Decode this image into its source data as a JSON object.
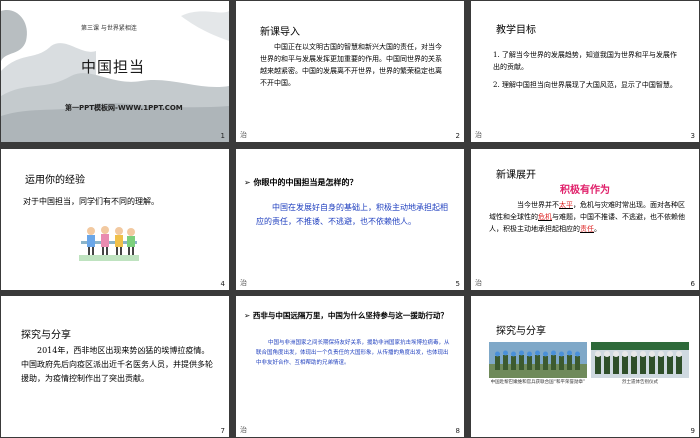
{
  "slides": [
    {
      "num": "1",
      "label": "第三课 与世界紧相连",
      "title": "中国担当",
      "subtitle": "第一PPT模板网-WWW.1PPT.COM"
    },
    {
      "num": "2",
      "footer": "治",
      "title": "新课导入",
      "text": "中国正在以文明古国的智慧和新兴大国的责任，对当今世界的和平与发展发挥更加重要的作用。中国同世界的关系越来越紧密。中国的发展离不开世界，世界的繁荣稳定也离不开中国。"
    },
    {
      "num": "3",
      "footer": "治",
      "title": "教学目标",
      "items": [
        "了解当今世界的发展趋势，知道我国为世界和平与发展作出的贡献。",
        "理解中国担当向世界展现了大国风范，显示了中国智慧。"
      ]
    },
    {
      "num": "4",
      "title": "运用你的经验",
      "text": "对于中国担当，同学们有不同的理解。"
    },
    {
      "num": "5",
      "footer": "治",
      "question": "你眼中的中国担当是怎样的？",
      "answer": "中国在发展好自身的基础上，积极主动地承担起相应的责任，不推诿、不逃避，也不依赖他人。"
    },
    {
      "num": "6",
      "footer": "治",
      "title": "新课展开",
      "heading": "积极有作为",
      "text_1": "当今世界并不",
      "blank_1": "太平",
      "text_2": "，危机与灾难时常出现。面对各种区域性和全球性的",
      "blank_2": "危机",
      "text_3": "与难题，中国不推诿、不逃避，也不依赖他人，积极主动地承担起相应的",
      "blank_3": "责任",
      "text_4": "。"
    },
    {
      "num": "7",
      "title": "探究与分享",
      "text": "2014年，西非地区出现来势凶猛的埃博拉疫情。中国政府先后向疫区派出近千名医务人员，并提供多轮援助，为疫情控制作出了突出贡献。"
    },
    {
      "num": "8",
      "footer": "治",
      "question": "西非与中国远隔万里，中国为什么坚持参与这一援助行动？",
      "answer": "中国与非洲国家之间长期保持友好关系，援助非洲国家抗击埃博拉病毒，从联合国角度出发，体现出一个负责任的大国形象，从传播的角度出发，也体现出中非友好合作、互相帮助的兄弟情谊。"
    },
    {
      "num": "9",
      "title": "探究与分享",
      "caption_1": "中国赴黎巴嫩维和官兵获联合国“和平荣誉勋章”",
      "caption_2": "烈士遗体告别仪式"
    }
  ],
  "colors": {
    "background": "#3a3a3a",
    "blue_text": "#1f3fbf",
    "red_text": "#dd2222",
    "pink_heading": "#e0206a"
  }
}
